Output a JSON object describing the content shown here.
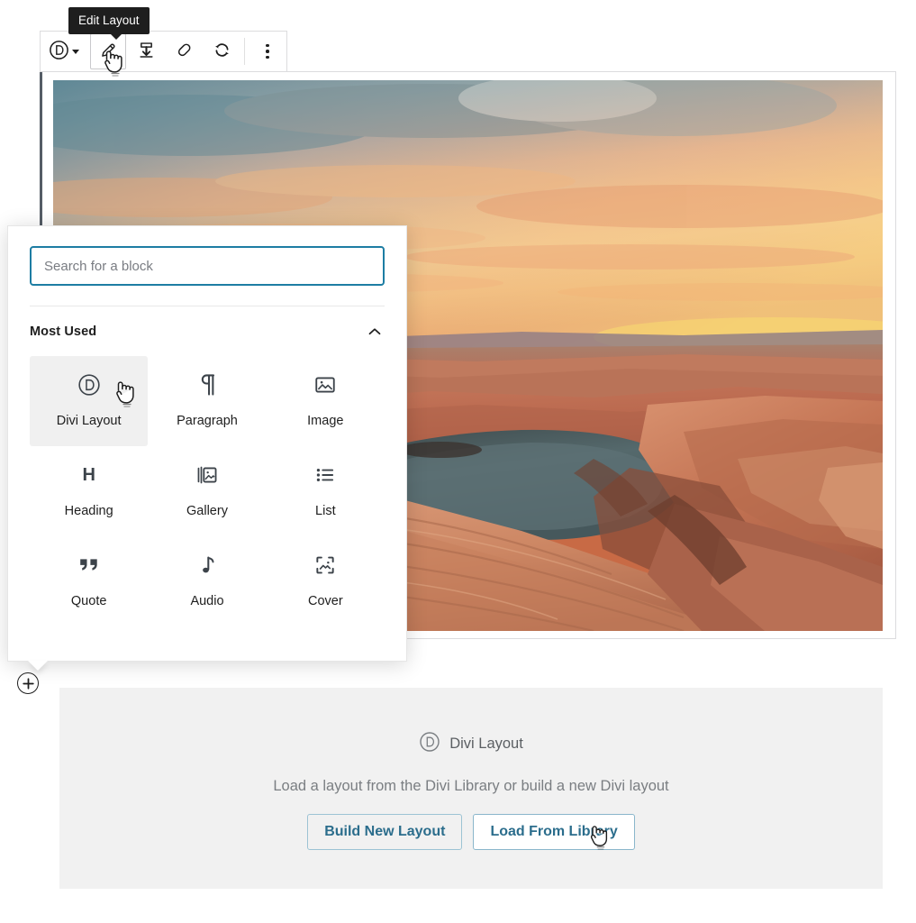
{
  "tooltip": {
    "text": "Edit Layout"
  },
  "toolbar": {
    "block_type_icon": "divi-logo-icon",
    "block_type_caret": "chevron-down-icon",
    "buttons": [
      {
        "name": "edit-layout-button",
        "icon": "pencil-icon",
        "label": "Edit Layout",
        "active": true
      },
      {
        "name": "save-to-library-button",
        "icon": "save-download-icon",
        "label": "Save to Library"
      },
      {
        "name": "clear-layout-button",
        "icon": "eraser-icon",
        "label": "Clear Layout"
      },
      {
        "name": "reload-layout-button",
        "icon": "refresh-icon",
        "label": "Reload Layout"
      }
    ],
    "more_options": {
      "name": "more-options-button",
      "icon": "kebab-menu-icon",
      "label": "More options"
    }
  },
  "cover_block": {
    "name": "cover-image-block",
    "alt": "Sunset over a red rock canyon with a river bend"
  },
  "inserter": {
    "search": {
      "placeholder": "Search for a block",
      "value": ""
    },
    "category": {
      "title": "Most Used",
      "collapse_icon": "chevron-up-icon",
      "expanded": true
    },
    "blocks": [
      {
        "label": "Divi Layout",
        "icon": "divi-logo-icon",
        "selected": true
      },
      {
        "label": "Paragraph",
        "icon": "pilcrow-icon",
        "selected": false
      },
      {
        "label": "Image",
        "icon": "image-icon",
        "selected": false
      },
      {
        "label": "Heading",
        "icon": "heading-h-icon",
        "selected": false
      },
      {
        "label": "Gallery",
        "icon": "gallery-icon",
        "selected": false
      },
      {
        "label": "List",
        "icon": "list-icon",
        "selected": false
      },
      {
        "label": "Quote",
        "icon": "quote-marks-icon",
        "selected": false
      },
      {
        "label": "Audio",
        "icon": "music-note-icon",
        "selected": false
      },
      {
        "label": "Cover",
        "icon": "cover-image-icon",
        "selected": false
      }
    ]
  },
  "appender": {
    "name": "add-block-button",
    "icon": "plus-circle-icon",
    "label": "Add block"
  },
  "divi_placeholder": {
    "icon": "divi-logo-icon",
    "title": "Divi Layout",
    "description": "Load a layout from the Divi Library or build a new Divi layout",
    "buttons": [
      {
        "label": "Build New Layout",
        "hovered": false
      },
      {
        "label": "Load From Library",
        "hovered": true
      }
    ]
  },
  "colors": {
    "accent_blue": "#2b6d8c",
    "search_border": "#1d7da3",
    "tooltip_bg": "#1e1e1e",
    "placeholder_bg": "#f1f1f1",
    "selected_block_bg": "#f0f0f0",
    "block_border": "#dcdcde",
    "select_bar": "#555d66"
  }
}
